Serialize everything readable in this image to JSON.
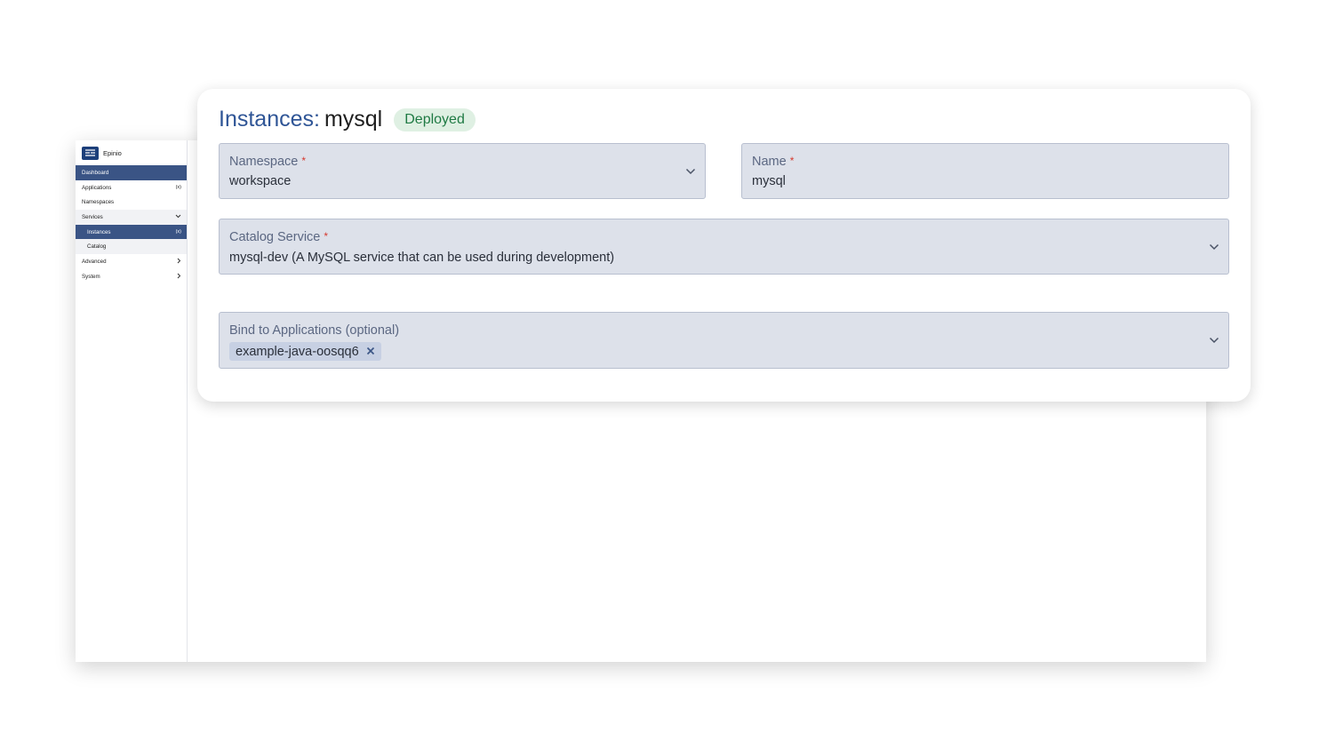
{
  "brand": {
    "name": "Epinio"
  },
  "sidebar": {
    "items": [
      {
        "label": "Dashboard"
      },
      {
        "label": "Applications",
        "count": "(x)"
      },
      {
        "label": "Namespaces"
      },
      {
        "label": "Services"
      },
      {
        "label": "Instances",
        "count": "(x)"
      },
      {
        "label": "Catalog"
      },
      {
        "label": "Advanced"
      },
      {
        "label": "System"
      }
    ]
  },
  "form": {
    "title_label": "Instances:",
    "title_value": "mysql",
    "status_badge": "Deployed",
    "namespace": {
      "label": "Namespace",
      "required_mark": "*",
      "value": "workspace"
    },
    "name": {
      "label": "Name",
      "required_mark": "*",
      "value": "mysql"
    },
    "catalog_service": {
      "label": "Catalog Service",
      "required_mark": "*",
      "value": "mysql-dev (A MySQL service that can be used during development)"
    },
    "bind_apps": {
      "label": "Bind to Applications (optional)",
      "tags": [
        "example-java-oosqq6"
      ]
    }
  },
  "colors": {
    "accent": "#2f5596",
    "sidebar_active": "#3a5485",
    "field_bg": "#dde1ea",
    "badge_bg": "#dff0e3",
    "badge_text": "#1f7a44",
    "required": "#d63a2f"
  }
}
